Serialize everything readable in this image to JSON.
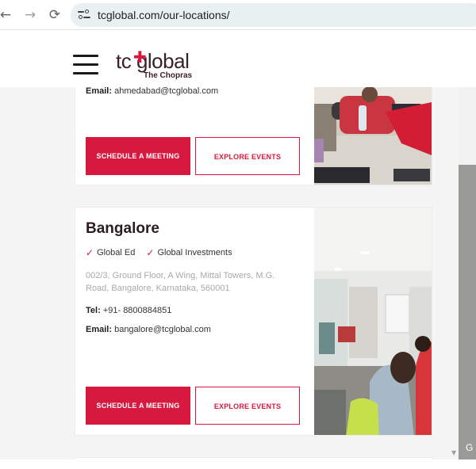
{
  "browser": {
    "back_icon": "←",
    "forward_icon": "→",
    "reload_icon": "⟳",
    "url": "tcglobal.com/our-locations/"
  },
  "header": {
    "logo_text": "tc global",
    "logo_subtitle": "The Chopras"
  },
  "locations": [
    {
      "email_label": "Email:",
      "email": "ahmedabad@tcglobal.com",
      "schedule_label": "SCHEDULE A MEETING",
      "events_label": "EXPLORE EVENTS"
    },
    {
      "city": "Bangalore",
      "services": [
        "Global Ed",
        "Global Investments"
      ],
      "address": "002/3, Ground Floor, A Wing, Mittal Towers, M.G. Road, Bangalore, Karnataka, 560001",
      "tel_label": "Tel:",
      "tel": "+91- 8800884851",
      "email_label": "Email:",
      "email": "bangalore@tcglobal.com",
      "schedule_label": "SCHEDULE A MEETING",
      "events_label": "EXPLORE EVENTS"
    }
  ],
  "side": {
    "g_label": "G"
  },
  "colors": {
    "accent": "#d7193f",
    "dark": "#2b1b22"
  }
}
